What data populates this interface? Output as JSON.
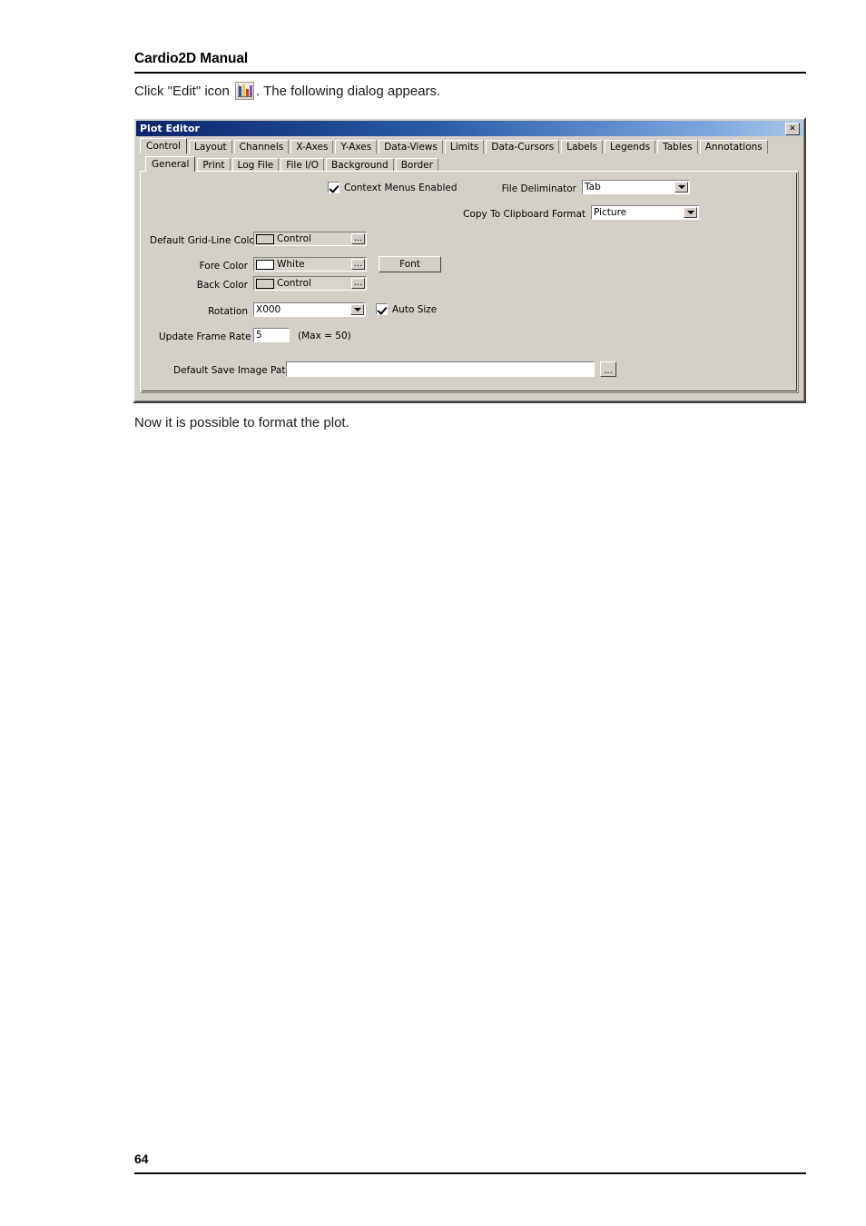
{
  "document": {
    "header_title": "Cardio2D Manual",
    "intro_before": "Click \"Edit\" icon",
    "intro_after": ". The following dialog appears.",
    "outro": "Now it is possible to format the plot.",
    "page_number": "64"
  },
  "dialog": {
    "title": "Plot Editor",
    "close_label": "✕",
    "main_tabs": [
      {
        "label": "Control",
        "active": true
      },
      {
        "label": "Layout",
        "active": false
      },
      {
        "label": "Channels",
        "active": false
      },
      {
        "label": "X-Axes",
        "active": false
      },
      {
        "label": "Y-Axes",
        "active": false
      },
      {
        "label": "Data-Views",
        "active": false
      },
      {
        "label": "Limits",
        "active": false
      },
      {
        "label": "Data-Cursors",
        "active": false
      },
      {
        "label": "Labels",
        "active": false
      },
      {
        "label": "Legends",
        "active": false
      },
      {
        "label": "Tables",
        "active": false
      },
      {
        "label": "Annotations",
        "active": false
      }
    ],
    "sub_tabs": [
      {
        "label": "General",
        "active": true
      },
      {
        "label": "Print",
        "active": false
      },
      {
        "label": "Log File",
        "active": false
      },
      {
        "label": "File I/O",
        "active": false
      },
      {
        "label": "Background",
        "active": false
      },
      {
        "label": "Border",
        "active": false
      }
    ],
    "form": {
      "context_menus": {
        "label": "Context Menus Enabled",
        "checked": true
      },
      "file_deliminator": {
        "label": "File Deliminator",
        "value": "Tab"
      },
      "copy_to_clipboard": {
        "label": "Copy To Clipboard Format",
        "value": "Picture"
      },
      "grid_line_color": {
        "label": "Default Grid-Line Color",
        "value": "Control",
        "swatch": "#d4d0c8",
        "browse": "..."
      },
      "fore_color": {
        "label": "Fore Color",
        "value": "White",
        "swatch": "#ffffff",
        "browse": "..."
      },
      "back_color": {
        "label": "Back Color",
        "value": "Control",
        "swatch": "#d4d0c8",
        "browse": "..."
      },
      "font_button": {
        "label": "Font"
      },
      "rotation": {
        "label": "Rotation",
        "value": "X000"
      },
      "auto_size": {
        "label": "Auto Size",
        "checked": true
      },
      "update_frame_rate": {
        "label": "Update Frame Rate",
        "value": "5",
        "note": "(Max = 50)"
      },
      "save_image_path": {
        "label": "Default Save Image Path",
        "value": "",
        "placeholder": "",
        "browse": "..."
      }
    }
  },
  "colors": {
    "dialog_face": "#d4d0c8",
    "titlebar_start": "#0a246a",
    "titlebar_end": "#a6c8ea",
    "text": "#000000"
  }
}
